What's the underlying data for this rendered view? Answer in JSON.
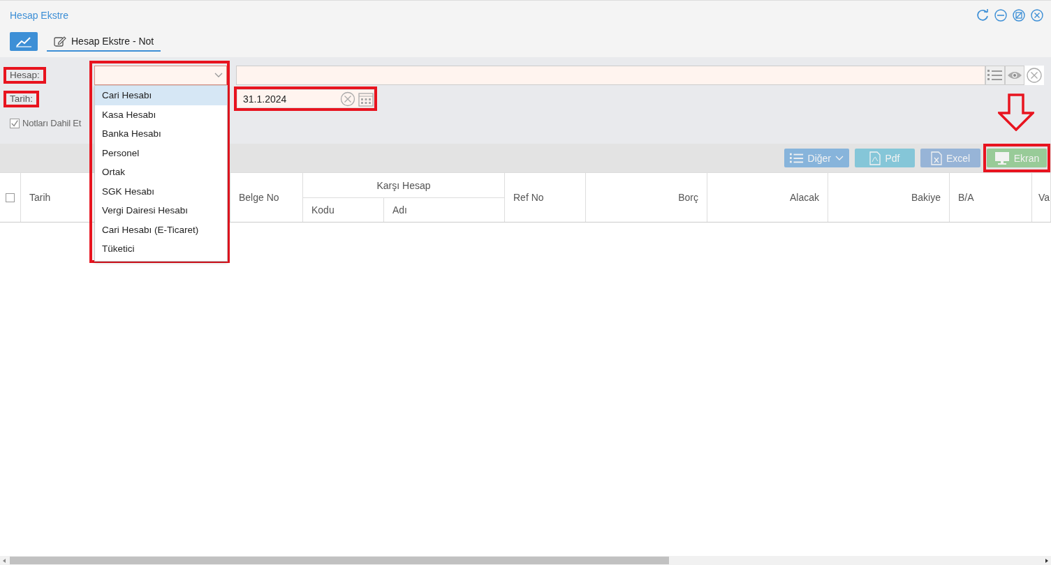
{
  "window": {
    "title": "Hesap Ekstre"
  },
  "tabs": [
    {
      "label": "Hesap Ekstre - Not",
      "selected": true
    }
  ],
  "form": {
    "hesap": {
      "label": "Hesap:",
      "dropdown": {
        "expanded": true,
        "options": [
          {
            "label": "Cari Hesabı",
            "selected": true
          },
          {
            "label": "Kasa Hesabı",
            "selected": false
          },
          {
            "label": "Banka Hesabı",
            "selected": false
          },
          {
            "label": "Personel",
            "selected": false
          },
          {
            "label": "Ortak",
            "selected": false
          },
          {
            "label": "SGK Hesabı",
            "selected": false
          },
          {
            "label": "Vergi Dairesi Hesabı",
            "selected": false
          },
          {
            "label": "Cari Hesabı (E-Ticaret)",
            "selected": false
          },
          {
            "label": "Tüketici",
            "selected": false
          }
        ]
      }
    },
    "tarih": {
      "label": "Tarih:",
      "value": "31.1.2024"
    },
    "include_notes": {
      "label": "Notları Dahil Et",
      "checked": true
    }
  },
  "toolbar": [
    {
      "label": "Diğer",
      "kind": "menu",
      "disabled": true
    },
    {
      "label": "Pdf",
      "kind": "pdf",
      "disabled": true
    },
    {
      "label": "Excel",
      "kind": "excel",
      "disabled": true
    },
    {
      "label": "Ekran",
      "kind": "screen",
      "disabled": true
    }
  ],
  "table": {
    "select_all": {
      "checked": false
    },
    "columns": [
      {
        "label": "Tarih"
      },
      {
        "label": "Belge No"
      },
      {
        "label": "Karşı Hesap",
        "children": [
          {
            "label": "Kodu"
          },
          {
            "label": "Adı"
          }
        ]
      },
      {
        "label": "Ref No"
      },
      {
        "label": "Borç"
      },
      {
        "label": "Alacak"
      },
      {
        "label": "Bakiye"
      },
      {
        "label": "B/A"
      },
      {
        "label": "Va"
      }
    ]
  }
}
